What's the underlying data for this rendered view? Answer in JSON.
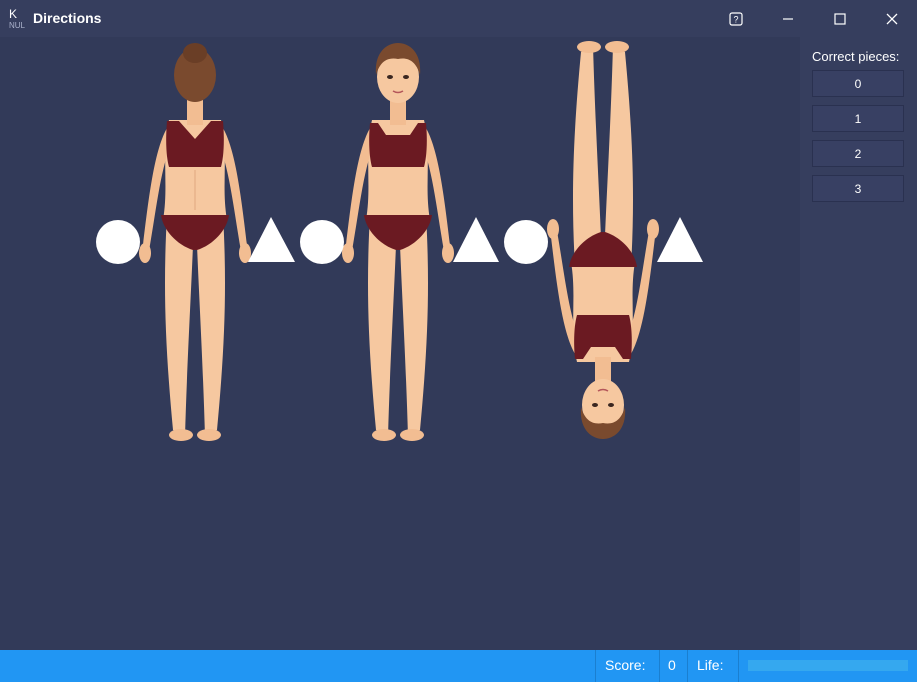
{
  "window": {
    "title": "Directions",
    "icons": [
      "app-logo-icon",
      "help-icon",
      "minimize-icon",
      "maximize-icon",
      "close-icon"
    ]
  },
  "sidebar": {
    "label": "Correct pieces:",
    "pieces": [
      "0",
      "1",
      "2",
      "3"
    ]
  },
  "status": {
    "score_label": "Score:",
    "score_value": "0",
    "life_label": "Life:",
    "life_fraction": 1.0
  },
  "colors": {
    "background": "#323a59",
    "panel": "#363e5e",
    "status_bar": "#2196f3",
    "skin": "#f6c8a0",
    "clothing": "#6b1a22",
    "hair": "#7a4a2e"
  },
  "figures": [
    {
      "view": "back",
      "orientation": "upright"
    },
    {
      "view": "front",
      "orientation": "upright"
    },
    {
      "view": "front",
      "orientation": "upside-down"
    }
  ]
}
